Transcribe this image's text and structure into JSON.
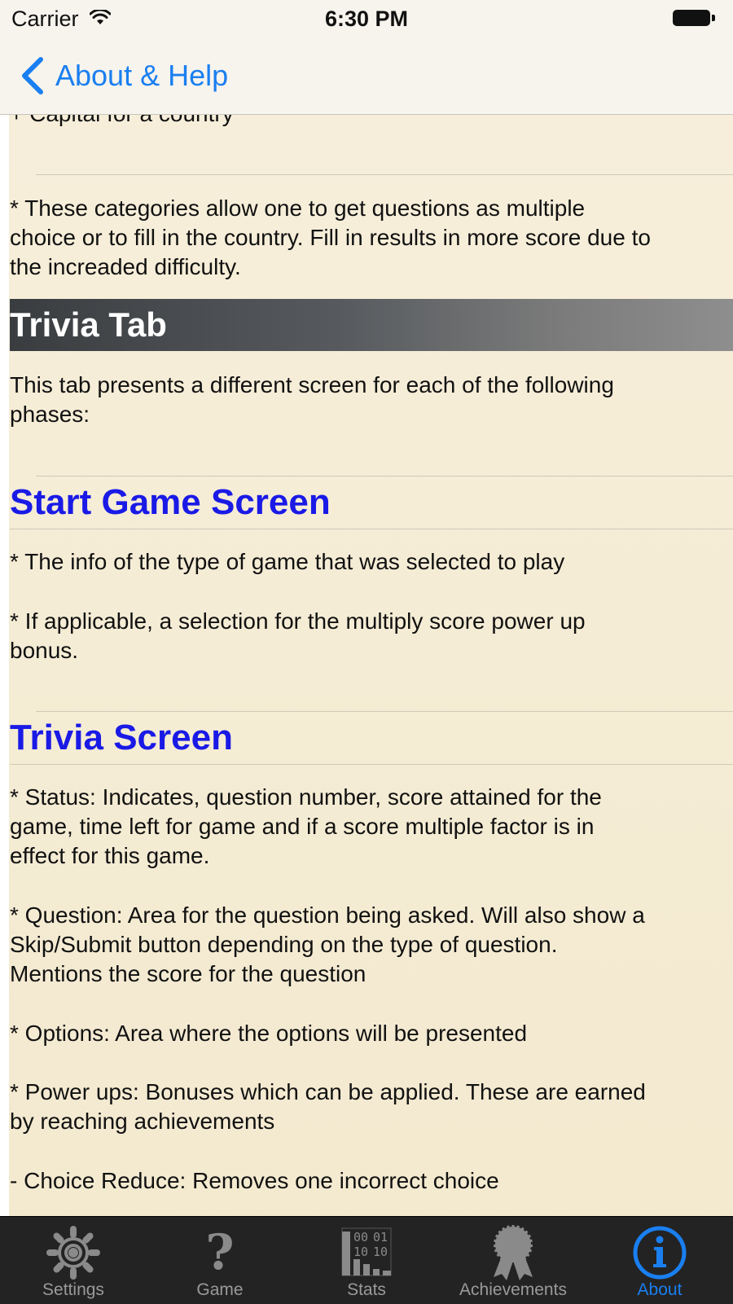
{
  "status_bar": {
    "carrier": "Carrier",
    "time": "6:30 PM"
  },
  "nav": {
    "back_label": "About & Help"
  },
  "content": {
    "clipped_line": "+ Capital for a country",
    "categories_note": [
      "* These categories allow one to get questions as multiple",
      "choice or to fill in the country. Fill in results in more score due to",
      "the increaded difficulty."
    ],
    "trivia_tab_heading": "Trivia Tab",
    "trivia_tab_intro": [
      "This tab presents a different screen for each of the following",
      "phases:"
    ],
    "start_game_heading": "Start Game Screen",
    "start_game_item1": " * The info of the type of game that was selected to play",
    "start_game_item2": [
      " * If applicable, a selection for the multiply score power up",
      "bonus."
    ],
    "trivia_screen_heading": "Trivia Screen",
    "status_item": [
      " * Status: Indicates, question number, score attained for the",
      "game, time left for game and if a score multiple factor is in",
      "effect for this game."
    ],
    "question_item": [
      " * Question: Area for the question being asked. Will also show a",
      "Skip/Submit button depending on the type of question.",
      "Mentions the score for the question"
    ],
    "options_item": " * Options: Area where the options will be presented",
    "powerups_item": [
      " * Power ups: Bonuses which can be applied. These are earned",
      "by reaching achievements"
    ],
    "choice_reduce_item": "    - Choice Reduce: Removes one incorrect choice"
  },
  "tab_bar": {
    "tabs": [
      {
        "label": "Settings",
        "icon": "gear-icon",
        "active": false
      },
      {
        "label": "Game",
        "icon": "question-mark-icon",
        "active": false
      },
      {
        "label": "Stats",
        "icon": "stats-icon",
        "active": false
      },
      {
        "label": "Achievements",
        "icon": "ribbon-icon",
        "active": false
      },
      {
        "label": "About",
        "icon": "info-icon",
        "active": true
      }
    ]
  },
  "colors": {
    "accent": "#1a7ff0",
    "heading_blue": "#1a1ae6",
    "tab_bar_bg": "#232323"
  }
}
